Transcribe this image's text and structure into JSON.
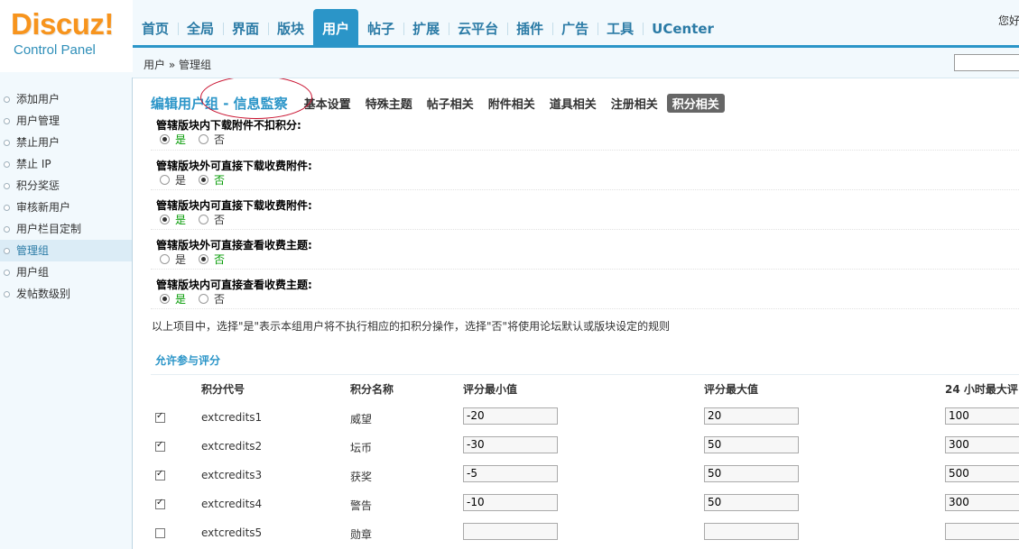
{
  "logo": {
    "brand": "Discuz!",
    "subtitle": "Control Panel"
  },
  "nav": [
    {
      "label": "首页",
      "active": false
    },
    {
      "label": "全局",
      "active": false
    },
    {
      "label": "界面",
      "active": false
    },
    {
      "label": "版块",
      "active": false
    },
    {
      "label": "用户",
      "active": true
    },
    {
      "label": "帖子",
      "active": false
    },
    {
      "label": "扩展",
      "active": false
    },
    {
      "label": "云平台",
      "active": false
    },
    {
      "label": "插件",
      "active": false
    },
    {
      "label": "广告",
      "active": false
    },
    {
      "label": "工具",
      "active": false
    },
    {
      "label": "UCenter",
      "active": false
    }
  ],
  "greeting": "您好",
  "breadcrumb": "用户 » 管理组",
  "sidebar": [
    {
      "label": "添加用户",
      "active": false
    },
    {
      "label": "用户管理",
      "active": false
    },
    {
      "label": "禁止用户",
      "active": false
    },
    {
      "label": "禁止 IP",
      "active": false
    },
    {
      "label": "积分奖惩",
      "active": false
    },
    {
      "label": "审核新用户",
      "active": false
    },
    {
      "label": "用户栏目定制",
      "active": false
    },
    {
      "label": "管理组",
      "active": true
    },
    {
      "label": "用户组",
      "active": false
    },
    {
      "label": "发帖数级别",
      "active": false
    }
  ],
  "page_title": "编辑用户组 - 信息監察",
  "subtabs": [
    {
      "label": "基本设置",
      "active": false
    },
    {
      "label": "特殊主题",
      "active": false
    },
    {
      "label": "帖子相关",
      "active": false
    },
    {
      "label": "附件相关",
      "active": false
    },
    {
      "label": "道具相关",
      "active": false
    },
    {
      "label": "注册相关",
      "active": false
    },
    {
      "label": "积分相关",
      "active": true
    }
  ],
  "yes_label": "是",
  "no_label": "否",
  "settings": [
    {
      "label": "管辖版块内下载附件不扣积分:",
      "value": "yes"
    },
    {
      "label": "管辖版块外可直接下载收费附件:",
      "value": "no"
    },
    {
      "label": "管辖版块内可直接下载收费附件:",
      "value": "yes"
    },
    {
      "label": "管辖版块外可直接查看收费主题:",
      "value": "no"
    },
    {
      "label": "管辖版块内可直接查看收费主题:",
      "value": "yes"
    }
  ],
  "note": "以上项目中，选择\"是\"表示本组用户将不执行相应的扣积分操作，选择\"否\"将使用论坛默认或版块设定的规则",
  "rating": {
    "title": "允许参与评分",
    "columns": [
      "积分代号",
      "积分名称",
      "评分最小值",
      "评分最大值",
      "24 小时最大评"
    ],
    "rows": [
      {
        "checked": true,
        "code": "extcredits1",
        "name": "威望",
        "min": "-20",
        "max": "20",
        "max24": "100"
      },
      {
        "checked": true,
        "code": "extcredits2",
        "name": "坛币",
        "min": "-30",
        "max": "50",
        "max24": "300"
      },
      {
        "checked": true,
        "code": "extcredits3",
        "name": "获奖",
        "min": "-5",
        "max": "50",
        "max24": "500"
      },
      {
        "checked": true,
        "code": "extcredits4",
        "name": "警告",
        "min": "-10",
        "max": "50",
        "max24": "300"
      },
      {
        "checked": false,
        "code": "extcredits5",
        "name": "勋章",
        "min": "",
        "max": "",
        "max24": ""
      }
    ]
  }
}
